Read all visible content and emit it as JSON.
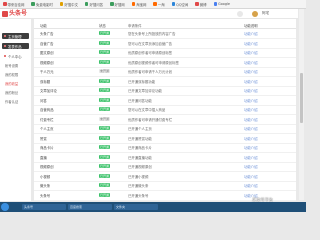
{
  "bookmarks": [
    {
      "label": "带来百佳网",
      "color": "#e04848"
    },
    {
      "label": "免费电影时",
      "color": "#3c9d5d"
    },
    {
      "label": "好搜中文",
      "color": "#e0a000"
    },
    {
      "label": "好搜问答",
      "color": "#3c9d5d"
    },
    {
      "label": "好搜网",
      "color": "#3c9d5d"
    },
    {
      "label": "淘宝网",
      "color": "#ff6a00"
    },
    {
      "label": "一淘",
      "color": "#ff6a00"
    },
    {
      "label": "QQ空间",
      "color": "#2d86d9"
    },
    {
      "label": "微博",
      "color": "#e04848"
    },
    {
      "label": "Google",
      "color": "#4a80f0"
    }
  ],
  "header": {
    "logo": "头条号",
    "username": "阿宅"
  },
  "sidebar": {
    "btn1": "主页管理",
    "btn2": "发表作品",
    "group": "个人中心",
    "items": [
      "帐号设置",
      "我的权限",
      "我的收益",
      "我的粉丝",
      "作者认证"
    ],
    "active_index": 2
  },
  "table": {
    "headers": [
      "功能",
      "状态",
      "申请条件",
      "功能说明"
    ],
    "rows": [
      {
        "name": "头条广告",
        "status": "已开通",
        "status_on": true,
        "desc": "您在头条号上所投放的内容广告",
        "action": "功能介绍"
      },
      {
        "name": "自营广告",
        "status": "已开通",
        "status_on": true,
        "desc": "您可以在文章页添加自营广告",
        "action": "功能介绍"
      },
      {
        "name": "图文原创",
        "status": "已开通",
        "status_on": true,
        "desc": "优质原创作者可申请原创标签",
        "action": "功能介绍"
      },
      {
        "name": "视频原创",
        "status": "已开通",
        "status_on": true,
        "desc": "优质原创视频作者可申请原创标签",
        "action": "功能介绍"
      },
      {
        "name": "千人万元",
        "status": "未开通",
        "status_on": false,
        "desc": "优质作者可申请千人万元计划",
        "action": "功能介绍"
      },
      {
        "name": "双标题",
        "status": "已开通",
        "status_on": true,
        "desc": "已开通双标题功能",
        "action": "功能介绍"
      },
      {
        "name": "文章加评论",
        "status": "已开通",
        "status_on": true,
        "desc": "已开通文章加评论功能",
        "action": "功能介绍"
      },
      {
        "name": "问答",
        "status": "已开通",
        "status_on": true,
        "desc": "已开通问答功能",
        "action": "功能介绍"
      },
      {
        "name": "自营商品",
        "status": "已开通",
        "status_on": true,
        "desc": "您可以在文章中插入商品",
        "action": "功能介绍"
      },
      {
        "name": "付费专栏",
        "status": "未开通",
        "status_on": false,
        "desc": "优质作者可申请开通付费专栏",
        "action": "功能介绍"
      },
      {
        "name": "个人主页",
        "status": "已开通",
        "status_on": true,
        "desc": "已开通个人主页",
        "action": "功能介绍"
      },
      {
        "name": "赞赏",
        "status": "已开通",
        "status_on": true,
        "desc": "已开通赞赏功能",
        "action": "功能介绍"
      },
      {
        "name": "商品卡片",
        "status": "已开通",
        "status_on": true,
        "desc": "已开通商品卡片",
        "action": "功能介绍"
      },
      {
        "name": "直播",
        "status": "已开通",
        "status_on": true,
        "desc": "已开通直播功能",
        "action": "功能介绍"
      },
      {
        "name": "视频原创",
        "status": "已开通",
        "status_on": true,
        "desc": "已开通视频原创",
        "action": "功能介绍"
      },
      {
        "name": "小视频",
        "status": "已开通",
        "status_on": true,
        "desc": "已开通小视频",
        "action": "功能介绍"
      },
      {
        "name": "微头条",
        "status": "已开通",
        "status_on": true,
        "desc": "已开通微头条",
        "action": "功能介绍"
      },
      {
        "name": "头条号",
        "status": "已开通",
        "status_on": true,
        "desc": "已开通头条号",
        "action": "功能介绍"
      }
    ]
  },
  "taskbar": {
    "items": [
      "头条号",
      "百度搜索",
      "文件夹"
    ]
  },
  "watermark": "买卖号平台"
}
